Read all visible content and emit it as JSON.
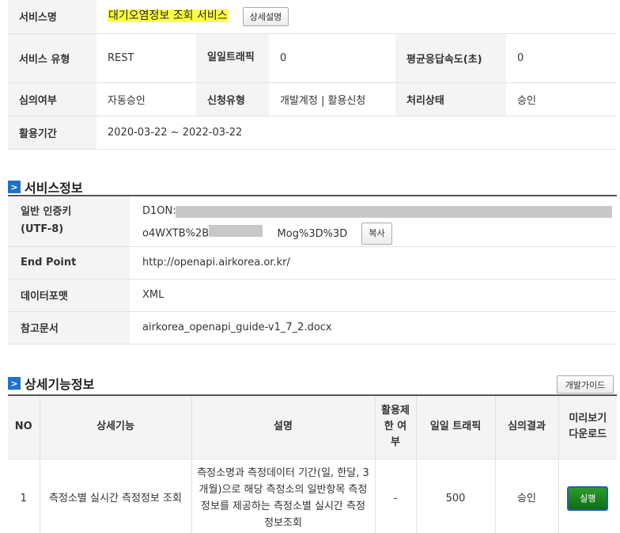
{
  "summary": {
    "service_name_label": "서비스명",
    "service_name": "대기오염정보 조회 서비스",
    "detail_button": "상세설명",
    "service_type_label": "서비스 유형",
    "service_type": "REST",
    "daily_traffic_label": "일일트래픽",
    "daily_traffic": "0",
    "avg_response_label": "평균응답속도(초)",
    "avg_response": "0",
    "review_label": "심의여부",
    "review": "자동승인",
    "request_type_label": "신청유형",
    "request_type": "개발계정 | 활용신청",
    "status_label": "처리상태",
    "status": "승인",
    "period_label": "활용기간",
    "period": "2020-03-22 ~ 2022-03-22"
  },
  "service_info": {
    "title": "서비스정보",
    "key_label": "일반 인증키\n(UTF-8)",
    "key_line1": "D1ON:",
    "key_line2_prefix": "o4WXTB%2Bn",
    "key_line2_suffix": "Mog%3D%3D",
    "copy_button": "복사",
    "endpoint_label": "End Point",
    "endpoint": "http://openapi.airkorea.or.kr/",
    "format_label": "데이터포맷",
    "format": "XML",
    "reference_label": "참고문서",
    "reference": "airkorea_openapi_guide-v1_7_2.docx"
  },
  "detail_info": {
    "title": "상세기능정보",
    "guide_button": "개발가이드",
    "headers": [
      "NO",
      "상세기능",
      "설명",
      "활용제한 여부",
      "일일 트래픽",
      "심의결과",
      "미리보기 다운로드"
    ],
    "rows": [
      {
        "no": "1",
        "function": "측정소별 실시간 측정정보 조회",
        "description": "측정소명과 측정데이터 기간(일, 한달, 3개월)으로 해당 측정소의 일반항목 측정정보를 제공하는 측정소별 실시간 측정정보조회",
        "limit": "-",
        "traffic": "500",
        "result": "승인",
        "run_button": "실행"
      }
    ]
  },
  "colors": {
    "highlight": "#ffff44",
    "section_icon": "#1e73c8",
    "run_button": "#1f8a1f"
  }
}
